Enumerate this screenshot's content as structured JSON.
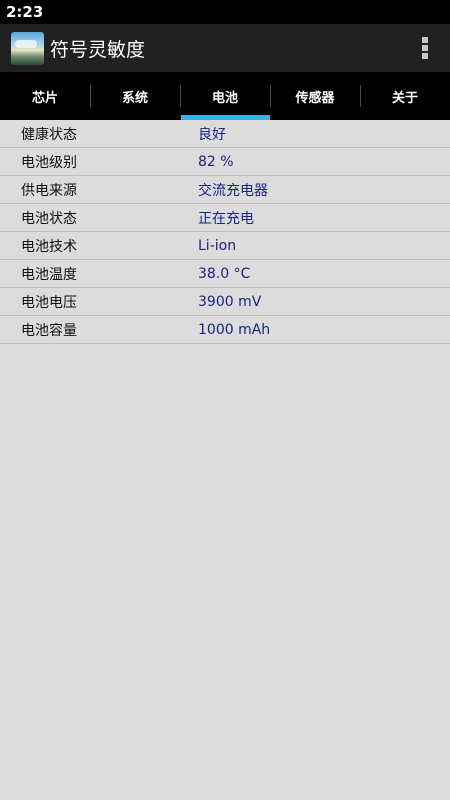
{
  "status_bar": {
    "time": "2:23"
  },
  "app_bar": {
    "title": "符号灵敏度",
    "icon": "app-landscape-icon",
    "menu_icon": "overflow-menu-icon"
  },
  "tabs": [
    {
      "label": "芯片",
      "active": false
    },
    {
      "label": "系统",
      "active": false
    },
    {
      "label": "电池",
      "active": true
    },
    {
      "label": "传感器",
      "active": false
    },
    {
      "label": "关于",
      "active": false
    }
  ],
  "battery_info": [
    {
      "label": "健康状态",
      "value": "良好"
    },
    {
      "label": "电池级别",
      "value": "82 %"
    },
    {
      "label": "供电来源",
      "value": "交流充电器"
    },
    {
      "label": "电池状态",
      "value": "正在充电"
    },
    {
      "label": "电池技术",
      "value": "Li-ion"
    },
    {
      "label": "电池温度",
      "value": "38.0 °C"
    },
    {
      "label": "电池电压",
      "value": "3900 mV"
    },
    {
      "label": "电池容量",
      "value": "1000 mAh"
    }
  ],
  "colors": {
    "tab_indicator": "#33b5e5",
    "value_text": "#1a237e",
    "app_bar": "#212121"
  }
}
